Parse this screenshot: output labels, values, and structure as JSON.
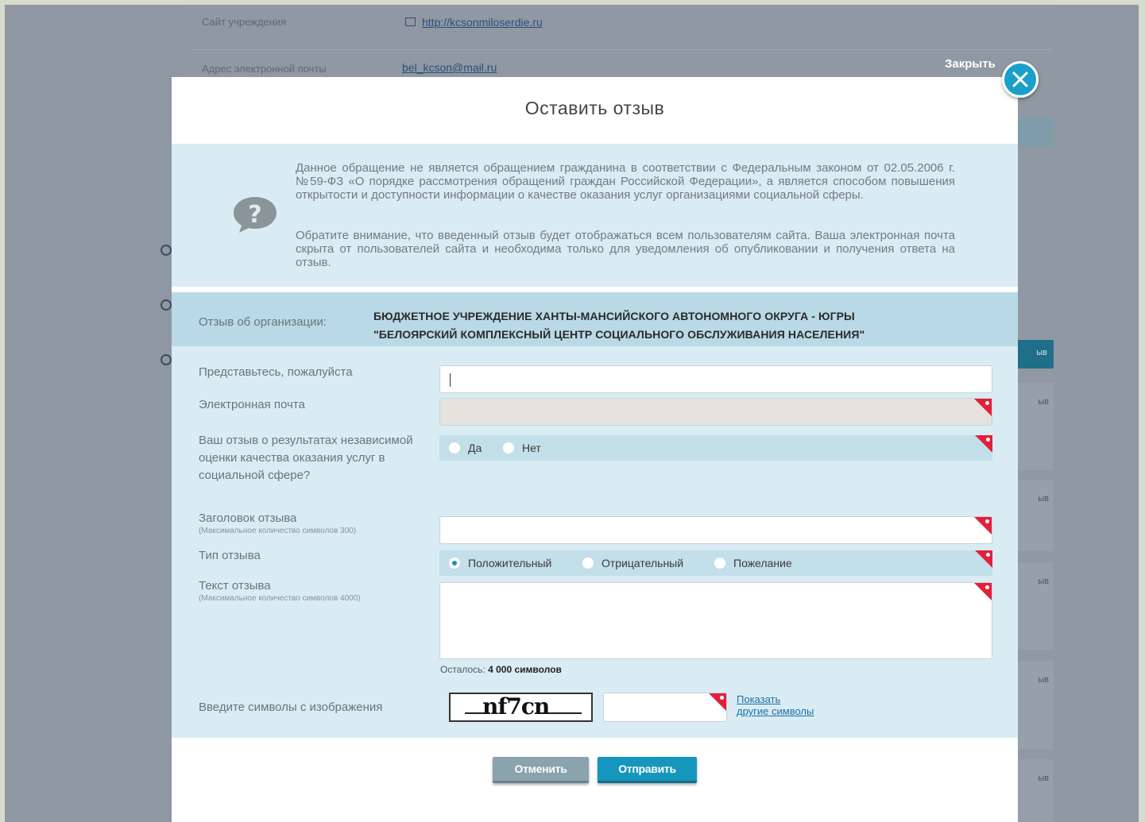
{
  "background": {
    "site_label": "Сайт учреждения",
    "site_url": "http://kcsonmiloserdie.ru",
    "email_label": "Адрес электронной почты",
    "email": "bel_kcson@mail.ru",
    "side_button_text": "ыв",
    "side_card_text": "ыв"
  },
  "close": {
    "label": "Закрыть"
  },
  "modal": {
    "title": "Оставить отзыв",
    "notice_1": "Данное обращение не является обращением гражданина в соответствии с Федеральным законом от 02.05.2006 г. №59-ФЗ «О порядке рассмотрения обращений граждан Российской Федерации», а является способом повышения открытости и доступности информации о качестве оказания услуг организациями социальной сферы.",
    "notice_2": "Обратите внимание, что введенный отзыв будет отображаться всем пользователям сайта. Ваша электронная почта скрыта от пользователей сайта и необходима только для уведомления об опубликовании и получения ответа на отзыв.",
    "org_label": "Отзыв об организации:",
    "org_name_line1": "БЮДЖЕТНОЕ УЧРЕЖДЕНИЕ ХАНТЫ-МАНСИЙСКОГО АВТОНОМНОГО ОКРУГА - ЮГРЫ",
    "org_name_line2": "\"БЕЛОЯРСКИЙ КОМПЛЕКСНЫЙ ЦЕНТР СОЦИАЛЬНОГО ОБСЛУЖИВАНИЯ НАСЕЛЕНИЯ\""
  },
  "form": {
    "name_label": "Представьтесь, пожалуйста",
    "name_value": "",
    "email_label": "Электронная почта",
    "email_value": "",
    "independent_label": "Ваш отзыв о результатах независимой оценки качества оказания услуг в социальной сфере?",
    "independent_options": [
      "Да",
      "Нет"
    ],
    "title_label": "Заголовок отзыва",
    "title_hint": "(Максимальное количество символов 300)",
    "type_label": "Тип отзыва",
    "type_options": [
      "Положительный",
      "Отрицательный",
      "Пожелание"
    ],
    "type_selected": "Положительный",
    "text_label": "Текст отзыва",
    "text_hint": "(Максимальное количество символов 4000)",
    "remaining_prefix": "Осталось:",
    "remaining_value": "4 000 символов",
    "captcha_label": "Введите символы с изображения",
    "captcha_text": "nf7cn",
    "captcha_link_line1": "Показать",
    "captcha_link_line2": "другие символы"
  },
  "buttons": {
    "cancel": "Отменить",
    "submit": "Отправить"
  },
  "colors": {
    "accent": "#1796bd",
    "required_marker": "#e2203b",
    "panel": "#d9ecf4"
  }
}
